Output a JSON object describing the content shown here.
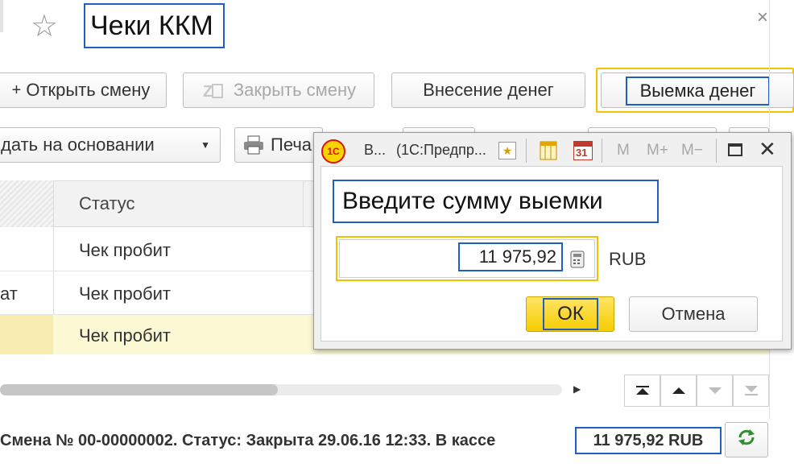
{
  "header": {
    "title": "Чеки ККМ",
    "close_glyph": "×"
  },
  "toolbar1": {
    "open_shift": "Открыть смену",
    "close_shift": "Закрыть смену",
    "deposit": "Внесение денег",
    "withdraw": "Выемка денег"
  },
  "toolbar2": {
    "create_based_on": "дать на основании",
    "print": "Печа"
  },
  "table": {
    "header_status": "Статус",
    "rows": [
      {
        "left_fragment": "",
        "status": "Чек пробит"
      },
      {
        "left_fragment": "ат",
        "status": "Чек пробит"
      },
      {
        "left_fragment": "",
        "status": "Чек пробит"
      }
    ]
  },
  "footer": {
    "status_text": "Смена № 00-00000002. Статус: Закрыта 29.06.16 12:33. В кассе",
    "amount": "11 975,92 RUB"
  },
  "dialog": {
    "tab_title": "В...",
    "app_title": "(1С:Предпр...",
    "logo_text": "1С",
    "calendar_number": "31",
    "memory_buttons": [
      "M",
      "M+",
      "M−"
    ],
    "prompt": "Введите сумму выемки",
    "amount_value": "11 975,92",
    "currency": "RUB",
    "ok_label": "ОК",
    "cancel_label": "Отмена"
  },
  "colors": {
    "accent_blue": "#1f5fbf",
    "highlight_yellow": "#f2c200",
    "selected_row": "#fbf8d4"
  },
  "icons": [
    "star-icon",
    "close-icon",
    "add-icon",
    "close-shift-icon",
    "dropdown-arrow-icon",
    "printer-icon",
    "1c-logo-icon",
    "bookmark-icon",
    "table-icon",
    "calendar-icon",
    "maximize-icon",
    "calculator-icon",
    "refresh-icon",
    "scroll-right-icon",
    "move-top-icon",
    "move-up-icon",
    "move-down-icon",
    "move-bottom-icon"
  ]
}
